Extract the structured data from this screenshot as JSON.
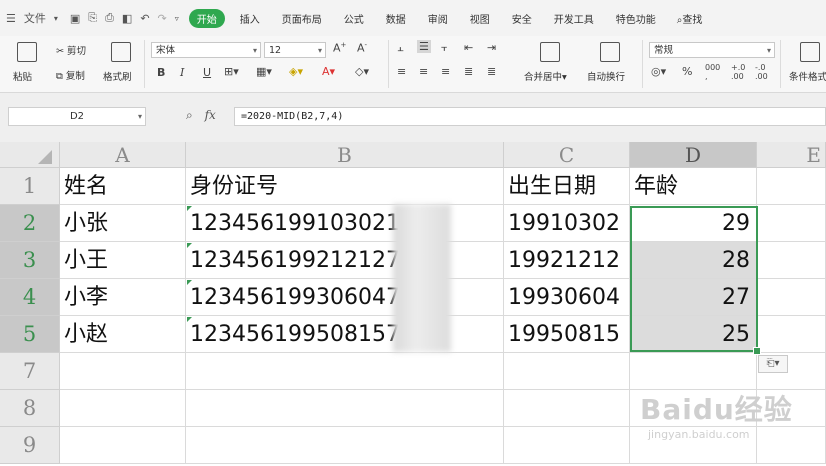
{
  "menubar": {
    "file_menu": "文件",
    "tabs": [
      {
        "label": "开始",
        "active": true
      },
      {
        "label": "插入"
      },
      {
        "label": "页面布局"
      },
      {
        "label": "公式"
      },
      {
        "label": "数据"
      },
      {
        "label": "审阅"
      },
      {
        "label": "视图"
      },
      {
        "label": "安全"
      },
      {
        "label": "开发工具"
      },
      {
        "label": "特色功能"
      }
    ],
    "search": "查找"
  },
  "ribbon": {
    "paste": "粘贴",
    "cut": "剪切",
    "copy": "复制",
    "format_painter": "格式刷",
    "font_name": "宋体",
    "font_size": "12",
    "bold": "B",
    "italic": "I",
    "underline": "U",
    "merge_center": "合并居中",
    "wrap_text": "自动换行",
    "number_format": "常规",
    "percent": "%",
    "thousands": "000",
    "conditional_format": "条件格式"
  },
  "formula_bar": {
    "name_box": "D2",
    "fx_label": "fx",
    "formula": "=2020-MID(B2,7,4)"
  },
  "sheet": {
    "columns": [
      "A",
      "B",
      "C",
      "D",
      "E"
    ],
    "rows": [
      "1",
      "2",
      "3",
      "4",
      "5",
      "7",
      "8",
      "9"
    ],
    "header_row": {
      "A": "姓名",
      "B": "身份证号",
      "C": "出生日期",
      "D": "年龄"
    },
    "data": [
      {
        "A": "小张",
        "B": "123456199103021",
        "C": "19910302",
        "D": "29"
      },
      {
        "A": "小王",
        "B": "123456199212127",
        "C": "19921212",
        "D": "28"
      },
      {
        "A": "小李",
        "B": "1234561993060470",
        "C": "19930604",
        "D": "27"
      },
      {
        "A": "小赵",
        "B": "1234561995081570",
        "C": "19950815",
        "D": "25"
      }
    ],
    "active_cell": "D2",
    "selection": "D2:D5"
  },
  "watermark": {
    "brand": "Baidu经验",
    "url": "jingyan.baidu.com"
  },
  "colors": {
    "accent": "#2fa84f",
    "selection_border": "#3a9a55"
  }
}
